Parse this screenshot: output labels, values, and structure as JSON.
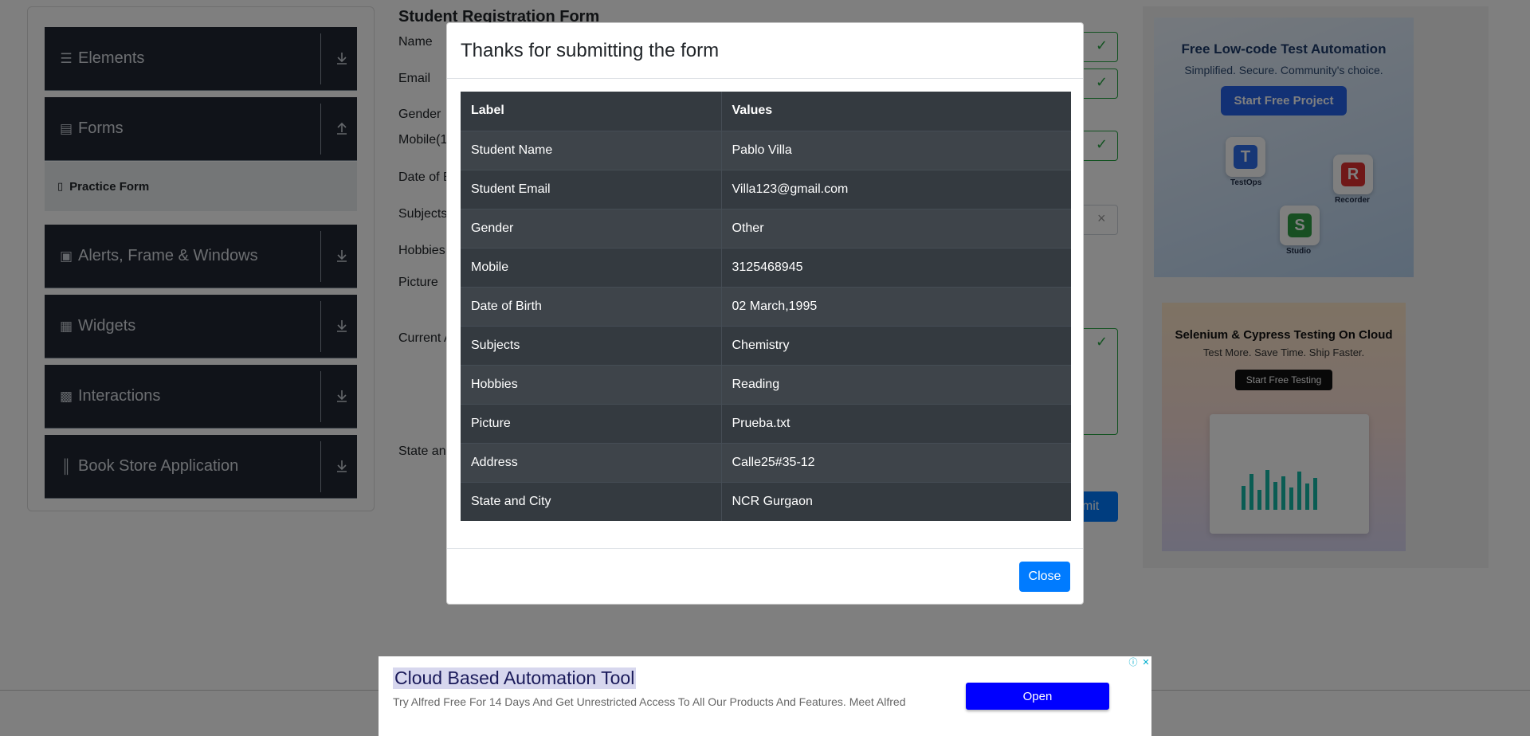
{
  "sidebar": {
    "groups": [
      {
        "label": "Elements",
        "icon": "hamburger-icon"
      },
      {
        "label": "Forms",
        "icon": "document-icon"
      },
      {
        "label": "Alerts, Frame & Windows",
        "icon": "window-icon"
      },
      {
        "label": "Widgets",
        "icon": "widgets-grid-icon"
      },
      {
        "label": "Interactions",
        "icon": "interactions-icon"
      },
      {
        "label": "Book Store Application",
        "icon": "books-icon"
      }
    ],
    "active_item": "Practice Form"
  },
  "form": {
    "title": "Student Registration Form",
    "labels": {
      "name": "Name",
      "email": "Email",
      "gender": "Gender",
      "mobile": "Mobile(1",
      "dob": "Date of B",
      "subjects": "Subjects",
      "hobbies": "Hobbies",
      "picture": "Picture",
      "address": "Current A",
      "state": "State and"
    },
    "submit_label": "bmit"
  },
  "ads": {
    "ad1": {
      "title": "Free Low-code Test Automation",
      "subtitle": "Simplified. Secure. Community's choice.",
      "button": "Start Free Project",
      "tiles": [
        "TestOps",
        "Recorder",
        "Studio"
      ]
    },
    "ad2": {
      "title": "Selenium & Cypress Testing On Cloud",
      "subtitle": "Test More. Save Time. Ship Faster.",
      "button": "Start Free Testing"
    }
  },
  "modal": {
    "title": "Thanks for submitting the form",
    "headers": [
      "Label",
      "Values"
    ],
    "rows": [
      {
        "label": "Student Name",
        "value": "Pablo Villa"
      },
      {
        "label": "Student Email",
        "value": "Villa123@gmail.com"
      },
      {
        "label": "Gender",
        "value": "Other"
      },
      {
        "label": "Mobile",
        "value": "3125468945"
      },
      {
        "label": "Date of Birth",
        "value": "02 March,1995"
      },
      {
        "label": "Subjects",
        "value": "Chemistry"
      },
      {
        "label": "Hobbies",
        "value": "Reading"
      },
      {
        "label": "Picture",
        "value": "Prueba.txt"
      },
      {
        "label": "Address",
        "value": "Calle25#35-12"
      },
      {
        "label": "State and City",
        "value": "NCR Gurgaon"
      }
    ],
    "close_label": "Close"
  },
  "bottom_ad": {
    "title": "Cloud Based Automation Tool",
    "description": "Try Alfred Free For 14 Days And Get Unrestricted Access To All Our Products And Features. Meet Alfred",
    "button": "Open"
  },
  "colors": {
    "primary": "#007bff",
    "sidebar_dark": "#202733",
    "table_dark": "#343a40",
    "valid_green": "#28a745",
    "ad_button": "#0000ff"
  }
}
